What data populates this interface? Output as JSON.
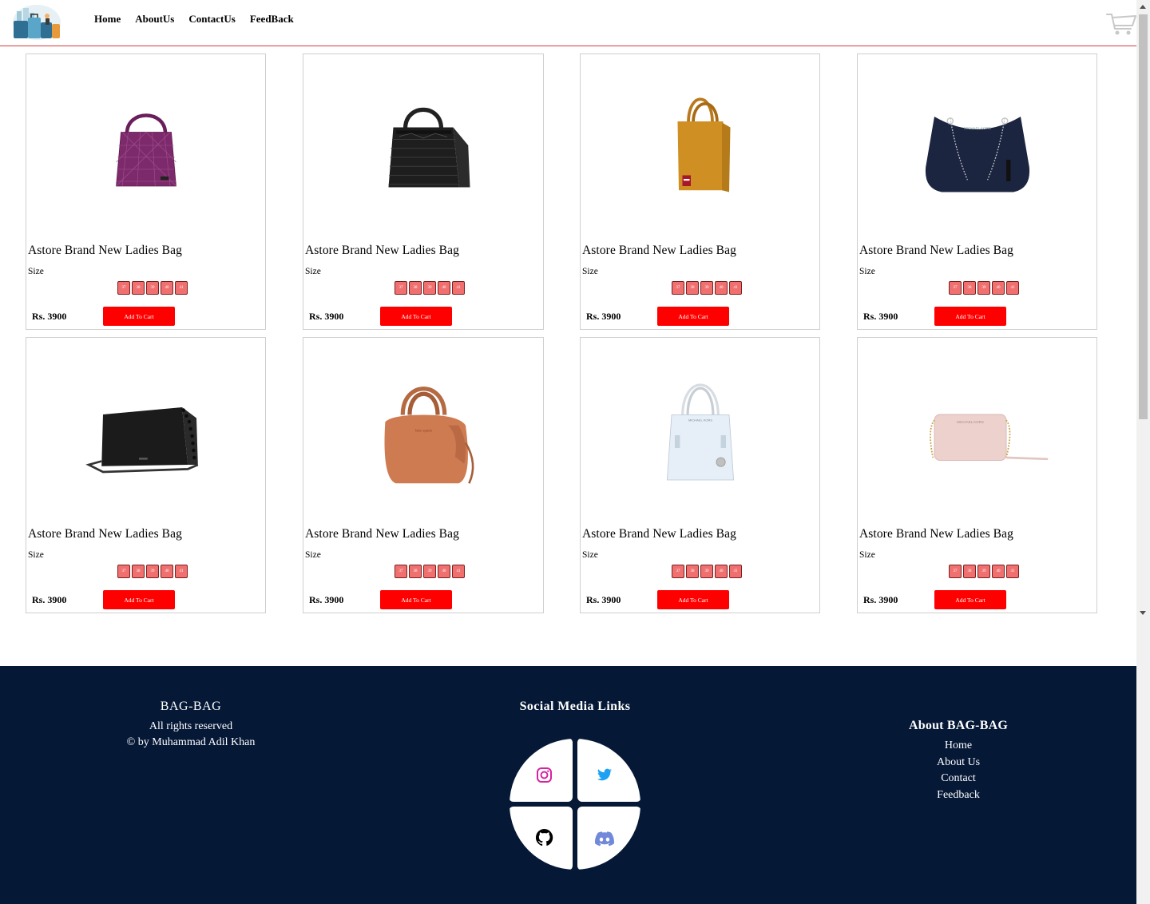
{
  "nav": {
    "links": [
      {
        "label": "Home"
      },
      {
        "label": "AboutUs"
      },
      {
        "label": "ContactUs"
      },
      {
        "label": "FeedBack"
      }
    ]
  },
  "colors": {
    "accent": "#ff0000",
    "footer_bg": "#051836",
    "nav_border": "#d43b3b",
    "size_chip": "#f07070"
  },
  "products": [
    {
      "title": "Astore Brand New Ladies Bag",
      "size_label": "Size",
      "price": "Rs. 3900",
      "button": "Add To Cart",
      "bag_color": "purple",
      "bag_icon": "tote-bag-icon"
    },
    {
      "title": "Astore Brand New Ladies Bag",
      "size_label": "Size",
      "price": "Rs. 3900",
      "button": "Add To Cart",
      "bag_color": "black",
      "bag_icon": "satchel-bag-icon"
    },
    {
      "title": "Astore Brand New Ladies Bag",
      "size_label": "Size",
      "price": "Rs. 3900",
      "button": "Add To Cart",
      "bag_color": "mustard",
      "bag_icon": "tote-bag-icon"
    },
    {
      "title": "Astore Brand New Ladies Bag",
      "size_label": "Size",
      "price": "Rs. 3900",
      "button": "Add To Cart",
      "bag_color": "navy",
      "bag_icon": "shoulder-bag-icon"
    },
    {
      "title": "Astore Brand New Ladies Bag",
      "size_label": "Size",
      "price": "Rs. 3900",
      "button": "Add To Cart",
      "bag_color": "black",
      "bag_icon": "crossbody-bag-icon"
    },
    {
      "title": "Astore Brand New Ladies Bag",
      "size_label": "Size",
      "price": "Rs. 3900",
      "button": "Add To Cart",
      "bag_color": "tan",
      "bag_icon": "handbag-icon"
    },
    {
      "title": "Astore Brand New Ladies Bag",
      "size_label": "Size",
      "price": "Rs. 3900",
      "button": "Add To Cart",
      "bag_color": "light-blue",
      "bag_icon": "tote-bag-icon"
    },
    {
      "title": "Astore Brand New Ladies Bag",
      "size_label": "Size",
      "price": "Rs. 3900",
      "button": "Add To Cart",
      "bag_color": "blush",
      "bag_icon": "camera-bag-icon"
    }
  ],
  "sizes": [
    "37",
    "38",
    "39",
    "40",
    "41"
  ],
  "footer": {
    "brand": "BAG-BAG",
    "rights": "All rights reserved",
    "credit": "© by Muhammad Adil Khan",
    "social_title": "Social Media Links",
    "social": [
      {
        "icon": "instagram-icon",
        "color": "#d6249f"
      },
      {
        "icon": "twitter-icon",
        "color": "#1da1f2"
      },
      {
        "icon": "github-icon",
        "color": "#000000"
      },
      {
        "icon": "discord-icon",
        "color": "#7289da"
      }
    ],
    "about_title": "About BAG-BAG",
    "about_links": [
      {
        "label": "Home"
      },
      {
        "label": "About Us"
      },
      {
        "label": "Contact"
      },
      {
        "label": "Feedback"
      }
    ]
  }
}
